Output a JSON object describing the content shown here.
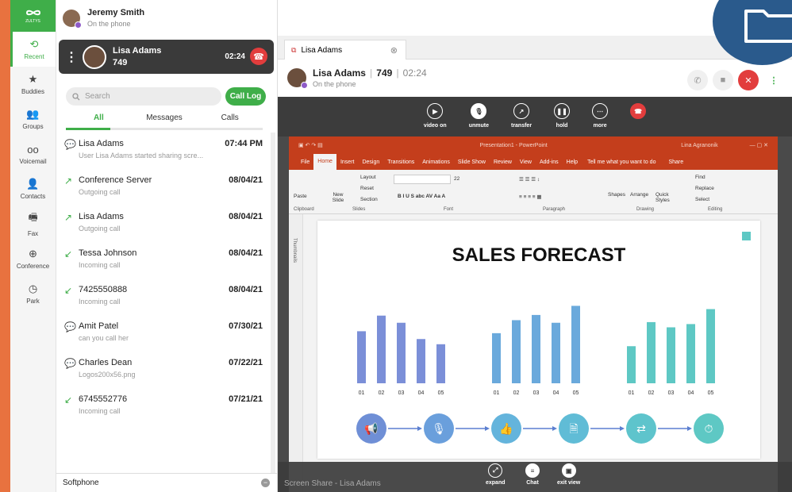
{
  "app": {
    "logo_text": "ZULTYS"
  },
  "rail": [
    {
      "label": "Recent",
      "icon": "recent-icon"
    },
    {
      "label": "Buddies",
      "icon": "star-icon"
    },
    {
      "label": "Groups",
      "icon": "groups-icon"
    },
    {
      "label": "Voicemail",
      "icon": "voicemail-icon"
    },
    {
      "label": "Contacts",
      "icon": "contacts-icon"
    },
    {
      "label": "Fax",
      "icon": "fax-icon"
    },
    {
      "label": "Conference",
      "icon": "conference-icon"
    },
    {
      "label": "Park",
      "icon": "park-icon"
    }
  ],
  "me": {
    "name": "Jeremy Smith",
    "status": "On the phone"
  },
  "active_call": {
    "name": "Lisa Adams",
    "ext": "749",
    "timer": "02:24"
  },
  "search": {
    "placeholder": "Search"
  },
  "call_log_label": "Call Log",
  "tabs": [
    "All",
    "Messages",
    "Calls"
  ],
  "list": [
    {
      "icon": "chat-icon",
      "name": "Lisa Adams",
      "date": "07:44 PM",
      "sub": "User Lisa Adams started sharing scre..."
    },
    {
      "icon": "outgoing-call-icon",
      "name": "Conference Server",
      "date": "08/04/21",
      "sub": "Outgoing call"
    },
    {
      "icon": "outgoing-call-icon",
      "name": "Lisa Adams",
      "date": "08/04/21",
      "sub": "Outgoing call"
    },
    {
      "icon": "incoming-call-icon",
      "name": "Tessa Johnson",
      "date": "08/04/21",
      "sub": "Incoming call"
    },
    {
      "icon": "incoming-call-icon",
      "name": "7425550888",
      "date": "08/04/21",
      "sub": "Incoming call"
    },
    {
      "icon": "chat-icon",
      "name": "Amit Patel",
      "date": "07/30/21",
      "sub": "can you call her"
    },
    {
      "icon": "chat-icon",
      "name": "Charles Dean",
      "date": "07/22/21",
      "sub": "Logos200x56.png"
    },
    {
      "icon": "incoming-call-icon",
      "name": "6745552776",
      "date": "07/21/21",
      "sub": "Incoming call"
    }
  ],
  "softphone": "Softphone",
  "right": {
    "tab": "Lisa Adams",
    "call_name": "Lisa Adams",
    "call_ext": "749",
    "call_time": "02:24",
    "call_status": "On the phone",
    "controls": [
      "video on",
      "unmute",
      "transfer",
      "hold",
      "more"
    ],
    "screen_share_label": "Screen Share - Lisa Adams",
    "bottom_controls": [
      "expand",
      "Chat",
      "exit view"
    ]
  },
  "ppt": {
    "title": "Presentation1 - PowerPoint",
    "user": "Lina Agranonik",
    "menu": [
      "File",
      "Home",
      "Insert",
      "Design",
      "Transitions",
      "Animations",
      "Slide Show",
      "Review",
      "View",
      "Add-ins",
      "Help",
      "Tell me what you want to do",
      "Share"
    ],
    "ribbon_groups": [
      "Clipboard",
      "Slides",
      "Font",
      "Paragraph",
      "Drawing",
      "Editing"
    ],
    "ribbon_items": {
      "paste": "Paste",
      "new_slide": "New Slide",
      "layout": "Layout",
      "reset": "Reset",
      "section": "Section",
      "font_size": "22",
      "shapes": "Shapes",
      "arrange": "Arrange",
      "quick_styles": "Quick Styles",
      "find": "Find",
      "replace": "Replace",
      "select": "Select"
    },
    "thumbnails_label": "Thumbnails",
    "slide_title": "SALES FORECAST",
    "chart_colors": [
      "#7b8fd8",
      "#6aa9dc",
      "#5ec8c4"
    ]
  },
  "chart_data": [
    {
      "type": "bar",
      "categories": [
        "01",
        "02",
        "03",
        "04",
        "05"
      ],
      "values": [
        80,
        104,
        93,
        68,
        60
      ],
      "color": "#7b8fd8"
    },
    {
      "type": "bar",
      "categories": [
        "01",
        "02",
        "03",
        "04",
        "05"
      ],
      "values": [
        77,
        97,
        105,
        93,
        119
      ],
      "color": "#6aa9dc"
    },
    {
      "type": "bar",
      "categories": [
        "01",
        "02",
        "03",
        "04",
        "05"
      ],
      "values": [
        57,
        94,
        86,
        91,
        114
      ],
      "color": "#5ec8c4"
    }
  ],
  "process_icons": [
    "megaphone-icon",
    "microphone-icon",
    "thumbs-up-icon",
    "document-icon",
    "exchange-icon",
    "stopwatch-icon"
  ]
}
